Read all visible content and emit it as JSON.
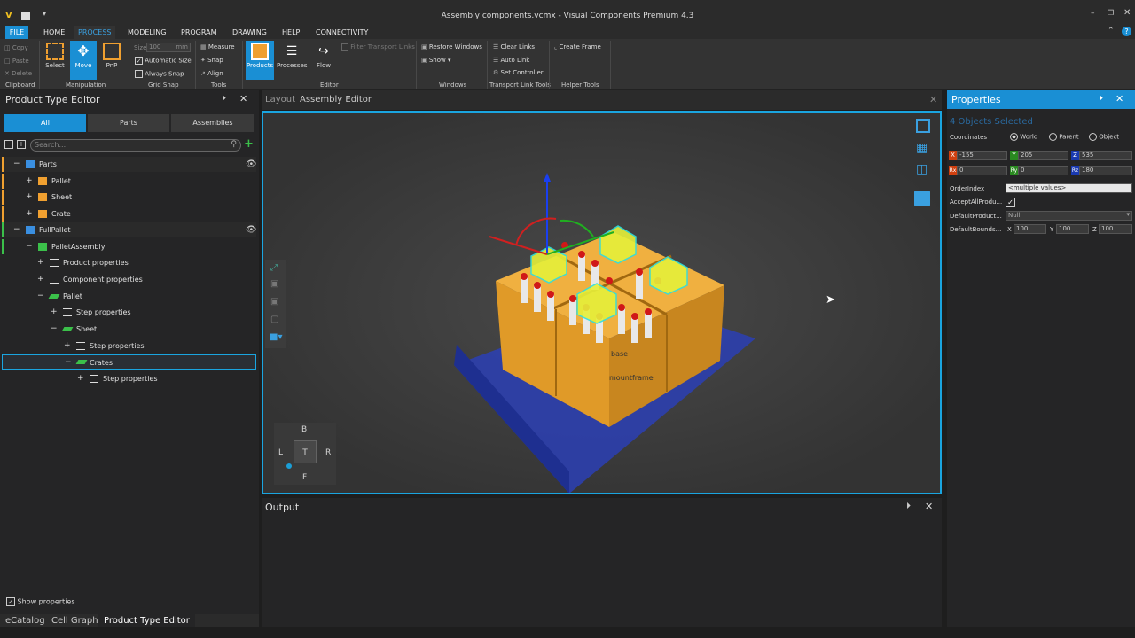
{
  "window": {
    "title": "Assembly components.vcmx - Visual Components Premium 4.3",
    "logo": "V"
  },
  "ribbon_tabs": [
    "FILE",
    "HOME",
    "PROCESS",
    "MODELING",
    "PROGRAM",
    "DRAWING",
    "HELP",
    "CONNECTIVITY"
  ],
  "ribbon": {
    "clipboard": {
      "copy": "Copy",
      "paste": "Paste",
      "delete": "Delete",
      "group": "Clipboard"
    },
    "manipulation": {
      "select": "Select",
      "move": "Move",
      "pnp": "PnP",
      "group": "Manipulation"
    },
    "grid_snap": {
      "size_label": "Size",
      "size_value": "100",
      "size_unit": "mm",
      "automatic_size": "Automatic Size",
      "always_snap": "Always Snap",
      "group": "Grid Snap"
    },
    "tools": {
      "measure": "Measure",
      "snap": "Snap",
      "align": "Align",
      "group": "Tools"
    },
    "editor": {
      "products": "Products",
      "processes": "Processes",
      "flow": "Flow",
      "filter": "Filter Transport Links",
      "group": "Editor"
    },
    "windows": {
      "restore": "Restore Windows",
      "show": "Show ▾",
      "group": "Windows"
    },
    "transport": {
      "clear": "Clear Links",
      "auto": "Auto Link",
      "set": "Set Controller",
      "group": "Transport Link Tools"
    },
    "helper": {
      "create": "Create Frame",
      "group": "Helper Tools"
    }
  },
  "left_panel": {
    "title": "Product Type Editor",
    "filter_tabs": [
      "All",
      "Parts",
      "Assemblies"
    ],
    "search_placeholder": "Search...",
    "tree": [
      {
        "label": "Parts",
        "pm": "−"
      },
      {
        "label": "Pallet",
        "pm": "+"
      },
      {
        "label": "Sheet",
        "pm": "+"
      },
      {
        "label": "Crate",
        "pm": "+"
      },
      {
        "label": "FullPallet",
        "pm": "−"
      },
      {
        "label": "PalletAssembly",
        "pm": "−"
      },
      {
        "label": "Product properties",
        "pm": "+"
      },
      {
        "label": "Component properties",
        "pm": "+"
      },
      {
        "label": "Pallet",
        "pm": "−"
      },
      {
        "label": "Step properties",
        "pm": "+"
      },
      {
        "label": "Sheet",
        "pm": "−"
      },
      {
        "label": "Step properties",
        "pm": "+"
      },
      {
        "label": "Crates",
        "pm": "−"
      },
      {
        "label": "Step properties",
        "pm": "+"
      }
    ],
    "show_properties": "Show properties",
    "bottom_tabs": [
      "eCatalog",
      "Cell Graph",
      "Product Type Editor"
    ]
  },
  "center": {
    "tabs": [
      "Layout",
      "Assembly Editor"
    ],
    "labels": {
      "base": "base",
      "frame": "mountframe"
    },
    "nav": {
      "top": "B",
      "left": "L",
      "center": "T",
      "right": "R",
      "bottom": "F"
    },
    "output_title": "Output"
  },
  "properties": {
    "title": "Properties",
    "selected": "4 Objects Selected",
    "coordinates_label": "Coordinates",
    "coord_options": [
      "World",
      "Parent",
      "Object"
    ],
    "x": "-155",
    "y": "205",
    "z": "535",
    "rx": "0",
    "ry": "0",
    "rz": "180",
    "axis_labels": {
      "x": "X",
      "y": "Y",
      "z": "Z",
      "rx": "Rx",
      "ry": "Ry",
      "rz": "Rz"
    },
    "order_index_label": "OrderIndex",
    "order_index_value": "<multiple values>",
    "accept_label": "AcceptAllProdu...",
    "default_product_label": "DefaultProduct...",
    "default_product_value": "Null",
    "default_bounds_label": "DefaultBounds...",
    "bounds": {
      "x": "100",
      "y": "100",
      "z": "100"
    }
  },
  "colors": {
    "accent": "#1aa5e0",
    "crate": "#e8a830",
    "pallet": "#2b3fb5",
    "cube": "#e6f03a"
  }
}
